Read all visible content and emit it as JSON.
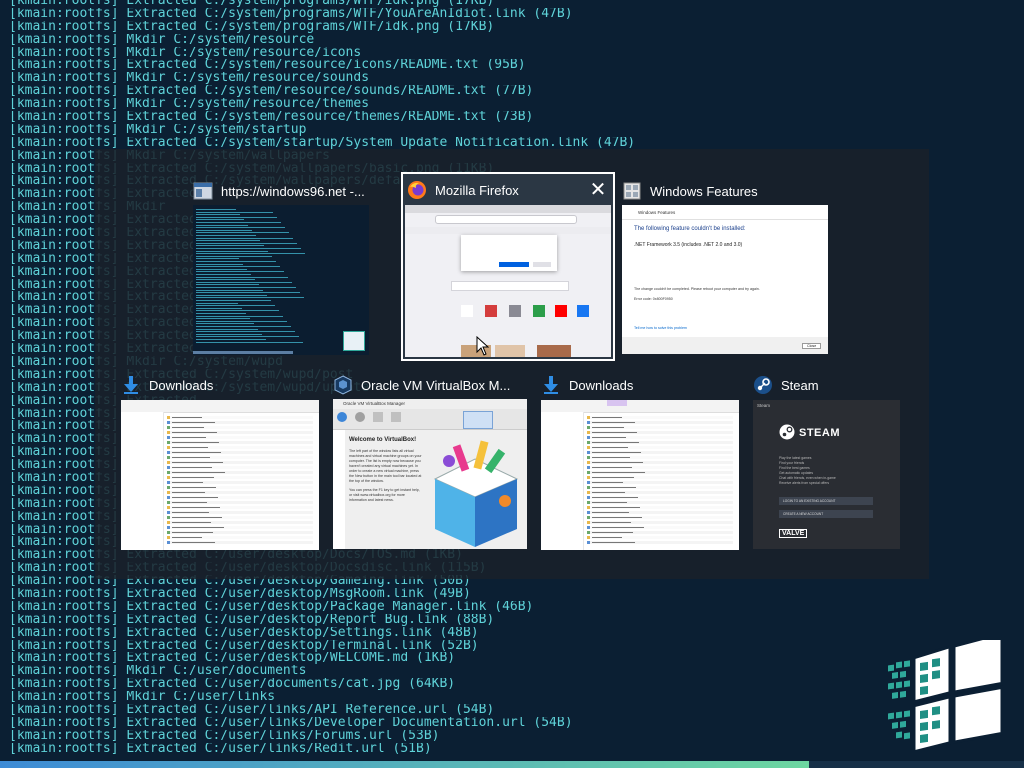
{
  "terminal": {
    "lines": [
      "[kmain:rootfs] Extracted C:/system/programs/WTF/idk.png (17KB)",
      "[kmain:rootfs] Extracted C:/system/programs/WTF/YouAreAnIdiot.link (47B)",
      "[kmain:rootfs] Extracted C:/system/programs/WTF/idk.png (17KB)",
      "[kmain:rootfs] Mkdir C:/system/resource",
      "[kmain:rootfs] Mkdir C:/system/resource/icons",
      "[kmain:rootfs] Extracted C:/system/resource/icons/README.txt (95B)",
      "[kmain:rootfs] Mkdir C:/system/resource/sounds",
      "[kmain:rootfs] Extracted C:/system/resource/sounds/README.txt (77B)",
      "[kmain:rootfs] Mkdir C:/system/resource/themes",
      "[kmain:rootfs] Extracted C:/system/resource/themes/README.txt (73B)",
      "[kmain:rootfs] Mkdir C:/system/startup",
      "[kmain:rootfs] Extracted C:/system/startup/System Update Notification.link (47B)",
      "[kmain:rootfs] Mkdir C:/system/wallpapers",
      "[kmain:rootfs] Extracted C:/system/wallpapers/basic.png (11KB)",
      "[kmain:rootfs] Extracted C:/system/wallpapers/default.png (110B)",
      "[kmain:rootfs] Extracted",
      "[kmain:rootfs] Mkdir",
      "[kmain:rootfs] Extracted",
      "[kmain:rootfs] Extracted",
      "[kmain:rootfs] Extracted",
      "[kmain:rootfs] Extracted",
      "[kmain:rootfs] Extracted",
      "[kmain:rootfs] Extracted",
      "[kmain:rootfs] Extracted",
      "[kmain:rootfs] Extracted",
      "[kmain:rootfs] Extracted",
      "[kmain:rootfs] Extracted",
      "[kmain:rootfs] Extracted",
      "[kmain:rootfs] Mkdir C:/system/wupd",
      "[kmain:rootfs] Extracted C:/system/wupd/post",
      "[kmain:rootfs] Extracted C:/system/wupd/update",
      "[kmain:rootfs] Extracted",
      "[kmain:rootfs] Extracted",
      "[kmain:rootfs] Extracted",
      "[kmain:rootfs] Extracted",
      "[kmain:rootfs] Extracted",
      "[kmain:rootfs] Extracted",
      "[kmain:rootfs] Extracted",
      "[kmain:rootfs] Extracted",
      "[kmain:rootfs] Extracted",
      "[kmain:rootfs] Extracted",
      "[kmain:rootfs] Extracted",
      "[kmain:rootfs] Extracted",
      "[kmain:rootfs] Extracted C:/user/desktop/Docs/TOS.md (1KB)",
      "[kmain:rootfs] Extracted C:/user/desktop/Docsdisc.link (115B)",
      "[kmain:rootfs] Extracted C:/user/desktop/Gameing.link (50B)",
      "[kmain:rootfs] Extracted C:/user/desktop/MsgRoom.link (49B)",
      "[kmain:rootfs] Extracted C:/user/desktop/Package Manager.link (46B)",
      "[kmain:rootfs] Extracted C:/user/desktop/Report Bug.link (88B)",
      "[kmain:rootfs] Extracted C:/user/desktop/Settings.link (48B)",
      "[kmain:rootfs] Extracted C:/user/desktop/Terminal.link (52B)",
      "[kmain:rootfs] Extracted C:/user/desktop/WELCOME.md (1KB)",
      "[kmain:rootfs] Mkdir C:/user/documents",
      "[kmain:rootfs] Extracted C:/user/documents/cat.jpg (64KB)",
      "[kmain:rootfs] Mkdir C:/user/links",
      "[kmain:rootfs] Extracted C:/user/links/API Reference.url (54B)",
      "[kmain:rootfs] Extracted C:/user/links/Developer Documentation.url (54B)",
      "[kmain:rootfs] Extracted C:/user/links/Forums.url (53B)",
      "[kmain:rootfs] Extracted C:/user/links/Redit.url (51B)"
    ]
  },
  "progress": {
    "fraction": 0.79
  },
  "switcher": {
    "windows": [
      {
        "title": "https://windows96.net -...",
        "icon": "browser-window-icon"
      },
      {
        "title": "Mozilla Firefox",
        "icon": "firefox-icon",
        "selected": true,
        "close_label": "✕"
      },
      {
        "title": "Windows Features",
        "icon": "windows-features-icon"
      },
      {
        "title": "Downloads",
        "icon": "download-arrow-icon"
      },
      {
        "title": "Oracle VM VirtualBox M...",
        "icon": "virtualbox-icon"
      },
      {
        "title": "Downloads",
        "icon": "download-arrow-icon"
      },
      {
        "title": "Steam",
        "icon": "steam-icon"
      }
    ]
  },
  "thumbs": {
    "features": {
      "window_title": "Windows Features",
      "heading": "The following feature couldn't be installed:",
      "feature": ".NET Framework 3.5 (includes .NET 2.0 and 3.0)",
      "message": "The change couldn't be completed. Please reboot your computer and try again.",
      "error": "Error code: 0x800F0950",
      "link": "Tell me how to solve this problem",
      "close": "Close"
    },
    "virtualbox": {
      "menu_title": "Oracle VM VirtualBox Manager",
      "welcome": "Welcome to VirtualBox!",
      "body": "The left part of the window lists all virtual machines and virtual machine groups on your computer. The list is empty now because you haven't created any virtual machines yet. In order to create a new virtual machine, press the New button in the main tool bar located at the top of the window.",
      "help": "You can press the F1 key to get instant help, or visit www.virtualbox.org for more information and latest news.",
      "tools": [
        "New",
        "Settings",
        "Discard",
        "Start"
      ],
      "machine_tools": "Machine Tools",
      "global_tools": "Global Tools"
    },
    "steam": {
      "title": "Steam",
      "logo_text": "STEAM",
      "features": [
        "Play the latest games",
        "Find your friends",
        "Find the best games",
        "Get automatic updates",
        "Chat with friends, even when in-game",
        "Receive alerts from special offers"
      ],
      "login": "LOGIN TO AN EXISTING ACCOUNT",
      "create": "CREATE A NEW ACCOUNT",
      "valve": "VALVE"
    },
    "downloads_files": [
      "Downloads",
      "Desktop",
      "Documents",
      "Music",
      "Pictures",
      "Videos",
      "This PC",
      "Network"
    ]
  }
}
